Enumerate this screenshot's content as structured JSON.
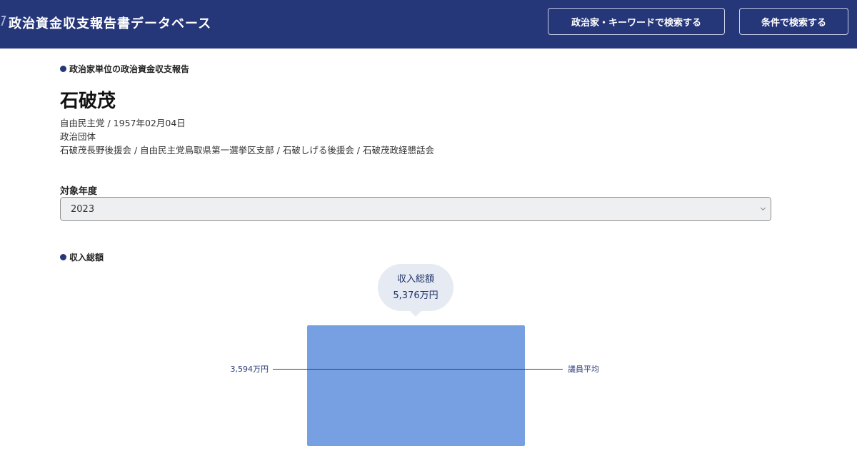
{
  "header": {
    "site_title": "政治資金収支報告書データベース",
    "search_keyword_button": "政治家・キーワードで検索する",
    "search_condition_button": "条件で検索する",
    "background_color": "#253679"
  },
  "profile": {
    "section_heading": "政治家単位の政治資金収支報告",
    "name": "石破茂",
    "party_and_birth": "自由民主党 / 1957年02月04日",
    "organization_heading": "政治団体",
    "organizations": "石破茂長野後援会 / 自由民主党鳥取県第一選挙区支部 / 石破しげる後援会 / 石破茂政経懇話会"
  },
  "year_filter": {
    "label": "対象年度",
    "selected": "2023"
  },
  "income_section": {
    "heading": "収入総額",
    "bubble_title": "収入総額",
    "bubble_value": "5,376万円",
    "average_value": "3,594万円",
    "average_label": "議員平均",
    "total_value_man_yen": 5376,
    "average_value_man_yen": 3594,
    "bar_color": "#76a0e2"
  },
  "icons": {
    "section_dot": "bullet-dot-icon",
    "select_chevron": "chevron-down-icon"
  }
}
